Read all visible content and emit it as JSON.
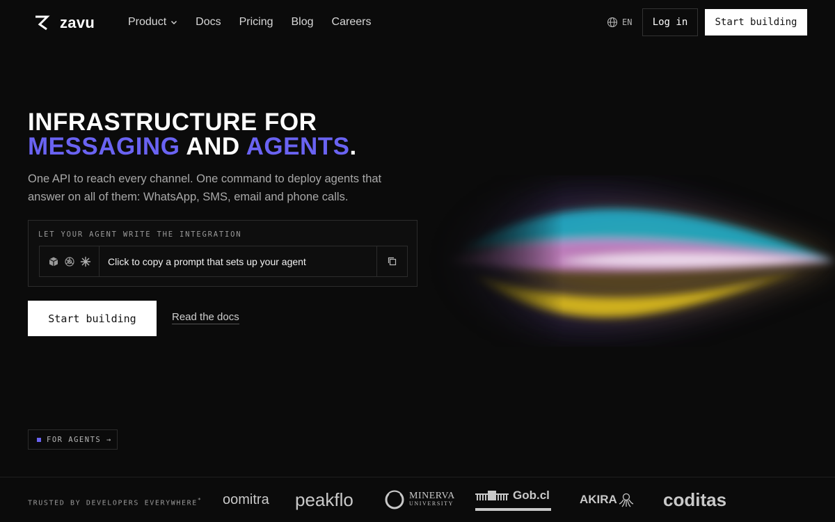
{
  "nav": {
    "logo_text": "zavu",
    "links": [
      "Product",
      "Docs",
      "Pricing",
      "Blog",
      "Careers"
    ],
    "lang": "EN",
    "login_label": "Log in",
    "start_label": "Start building"
  },
  "hero": {
    "title_line1": "INFRASTRUCTURE FOR",
    "title_word_messaging": "MESSAGING",
    "title_word_and": "AND",
    "title_word_agents": "AGENTS",
    "title_period": ".",
    "subtitle": "One API to reach every channel. One command to deploy agents that answer on all of them: WhatsApp, SMS, email and phone calls.",
    "agent_label": "LET YOUR AGENT WRITE THE INTEGRATION",
    "agent_prompt": "Click to copy a prompt that sets up your agent",
    "cta_start": "Start building",
    "cta_docs": "Read the docs",
    "agents_tag": "FOR AGENTS →"
  },
  "trusted": {
    "label": "TRUSTED BY DEVELOPERS EVERYWHERE",
    "label_mark": "*",
    "logos": [
      "oomitra",
      "peakflo",
      "MINERVA",
      "UNIVERSITY",
      "Gob.cl",
      "AKIRA",
      "coditas"
    ]
  },
  "colors": {
    "accent": "#6a63f2",
    "background": "#0b0b0b"
  }
}
